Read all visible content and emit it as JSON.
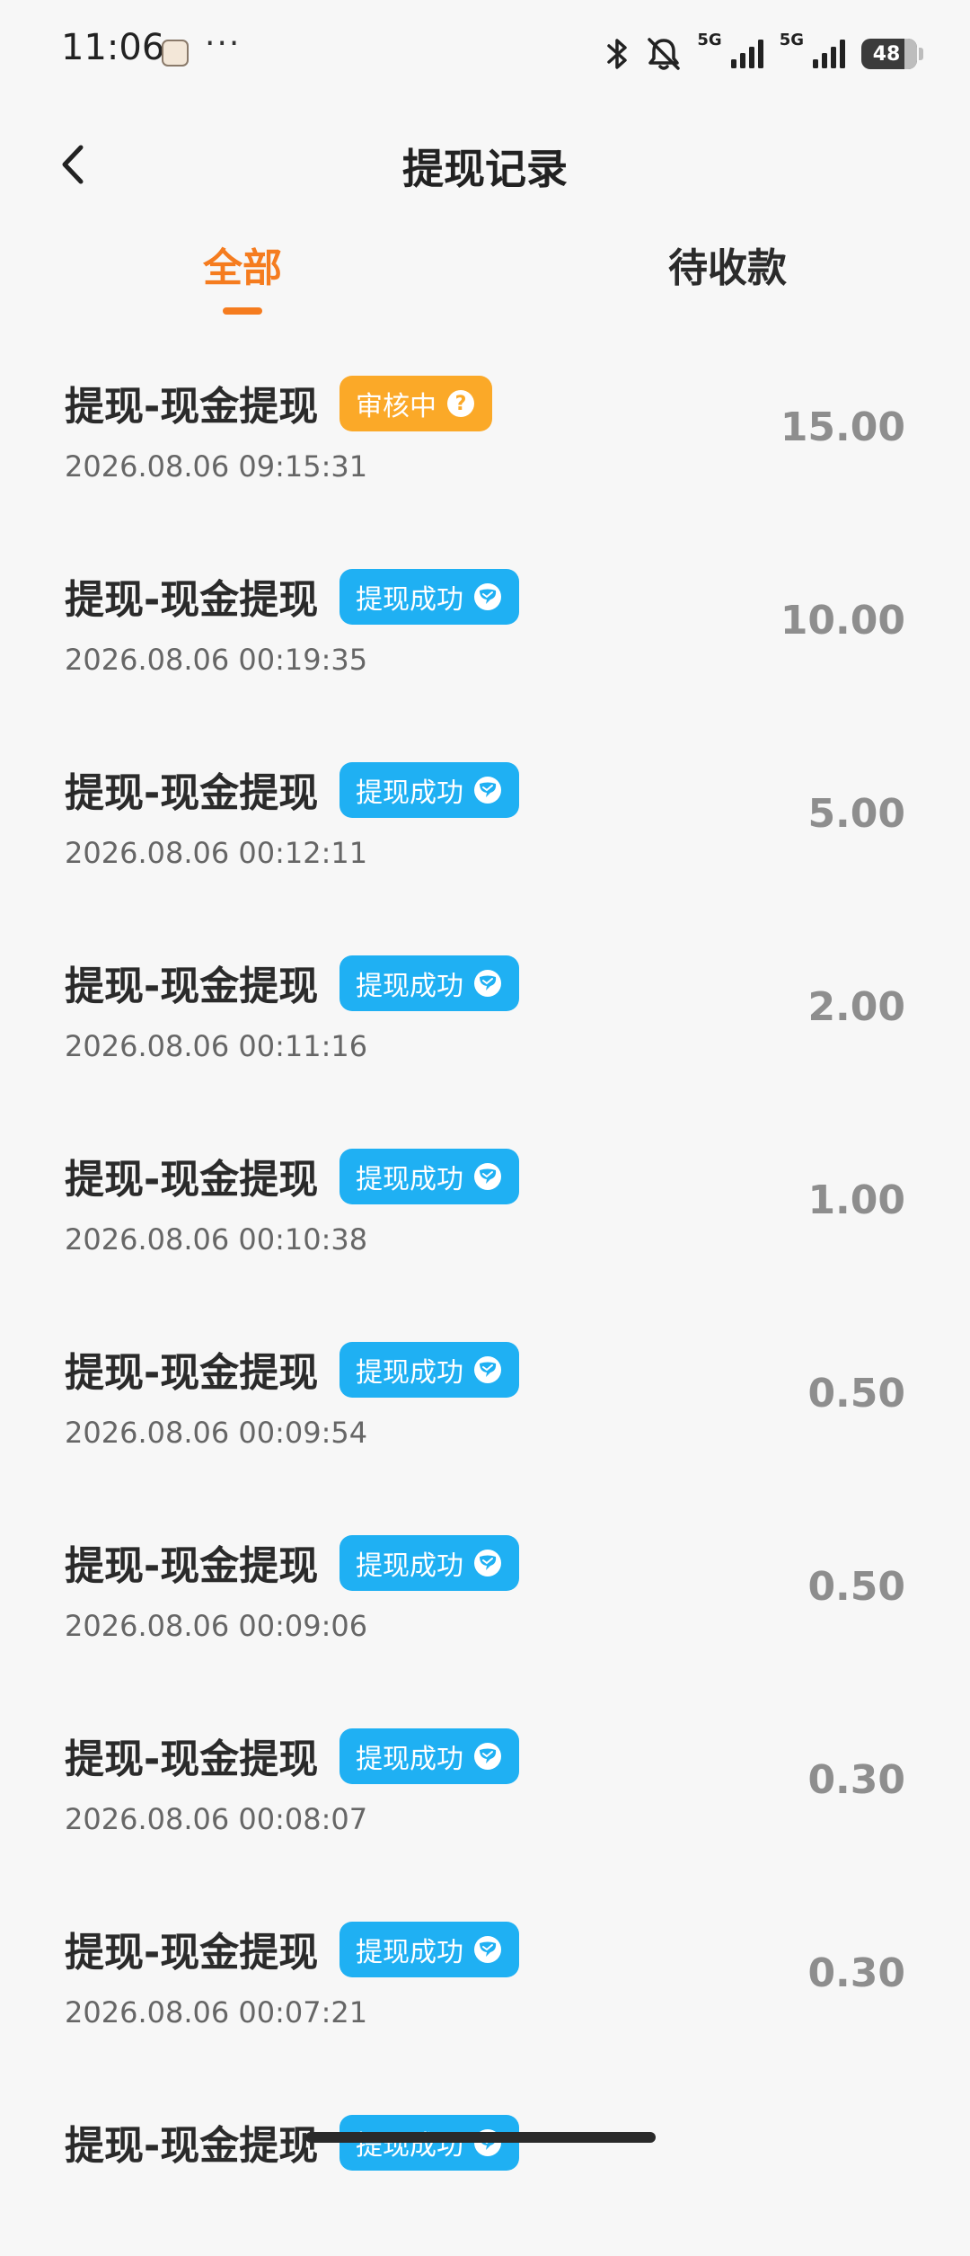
{
  "status_bar": {
    "time": "11:06",
    "more": "···",
    "network_1": "5G",
    "network_2": "5G",
    "battery": "48"
  },
  "header": {
    "title": "提现记录"
  },
  "tabs": [
    {
      "label": "全部",
      "active": true
    },
    {
      "label": "待收款",
      "active": false
    }
  ],
  "records": [
    {
      "title": "提现-现金提现",
      "status": "审核中",
      "status_type": "review",
      "time": "2026.08.06 09:15:31",
      "amount": "15.00"
    },
    {
      "title": "提现-现金提现",
      "status": "提现成功",
      "status_type": "success",
      "time": "2026.08.06 00:19:35",
      "amount": "10.00"
    },
    {
      "title": "提现-现金提现",
      "status": "提现成功",
      "status_type": "success",
      "time": "2026.08.06 00:12:11",
      "amount": "5.00"
    },
    {
      "title": "提现-现金提现",
      "status": "提现成功",
      "status_type": "success",
      "time": "2026.08.06 00:11:16",
      "amount": "2.00"
    },
    {
      "title": "提现-现金提现",
      "status": "提现成功",
      "status_type": "success",
      "time": "2026.08.06 00:10:38",
      "amount": "1.00"
    },
    {
      "title": "提现-现金提现",
      "status": "提现成功",
      "status_type": "success",
      "time": "2026.08.06 00:09:54",
      "amount": "0.50"
    },
    {
      "title": "提现-现金提现",
      "status": "提现成功",
      "status_type": "success",
      "time": "2026.08.06 00:09:06",
      "amount": "0.50"
    },
    {
      "title": "提现-现金提现",
      "status": "提现成功",
      "status_type": "success",
      "time": "2026.08.06 00:08:07",
      "amount": "0.30"
    },
    {
      "title": "提现-现金提现",
      "status": "提现成功",
      "status_type": "success",
      "time": "2026.08.06 00:07:21",
      "amount": "0.30"
    },
    {
      "title": "提现-现金提现",
      "status": "提现成功",
      "status_type": "success",
      "time": "",
      "amount": ""
    }
  ],
  "colors": {
    "accent": "#f57c1f",
    "review_badge": "#fba928",
    "success_badge": "#1fb0f3",
    "background": "#f7f7f7"
  },
  "icons": {
    "back": "chevron-left-icon",
    "review": "question-icon",
    "success": "chat-bubble-icon",
    "bluetooth": "bluetooth-icon",
    "mute": "bell-off-icon",
    "signal": "signal-icon",
    "battery": "battery-icon"
  }
}
